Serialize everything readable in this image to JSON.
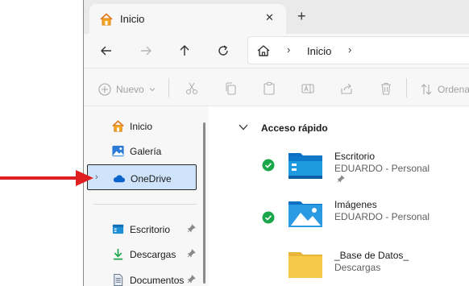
{
  "window": {
    "tab_title": "Inicio",
    "tab_close": "✕",
    "new_tab": "+"
  },
  "nav": {
    "back_icon": "arrow-left-icon",
    "forward_icon": "arrow-right-icon",
    "up_icon": "arrow-up-icon",
    "refresh_icon": "refresh-icon",
    "address_home_icon": "home-icon",
    "address_separator": "›",
    "address_location": "Inicio"
  },
  "toolbar": {
    "new_label": "Nuevo",
    "order_label": "Ordena",
    "icons": [
      "cut-icon",
      "copy-icon",
      "paste-icon",
      "rename-icon",
      "share-icon",
      "delete-icon"
    ]
  },
  "sidebar": {
    "items": [
      {
        "label": "Inicio",
        "icon": "home-icon"
      },
      {
        "label": "Galería",
        "icon": "gallery-icon"
      },
      {
        "label": "OneDrive",
        "icon": "cloud-icon",
        "selected": true,
        "expander": "›"
      },
      {
        "label": "Escritorio",
        "icon": "desktop-icon",
        "pinned": true
      },
      {
        "label": "Descargas",
        "icon": "download-icon",
        "pinned": true
      },
      {
        "label": "Documentos",
        "icon": "document-icon",
        "pinned": true
      }
    ]
  },
  "main": {
    "group_title": "Acceso rápido",
    "items": [
      {
        "name": "Escritorio",
        "location": "EDUARDO - Personal",
        "status": "synced",
        "pinned": true,
        "folder": "desktop-folder"
      },
      {
        "name": "Imágenes",
        "location": "EDUARDO - Personal",
        "status": "synced",
        "pinned": false,
        "folder": "pictures-folder"
      },
      {
        "name": "_Base de Datos_",
        "location": "Descargas",
        "status": "none",
        "pinned": false,
        "folder": "plain-folder"
      }
    ]
  },
  "colors": {
    "accent": "#0a64c9",
    "selected_bg": "#cfe3fb",
    "synced_green": "#1aa64a",
    "annotation_red": "#e02020",
    "folder_yellow": "#f7c948"
  }
}
